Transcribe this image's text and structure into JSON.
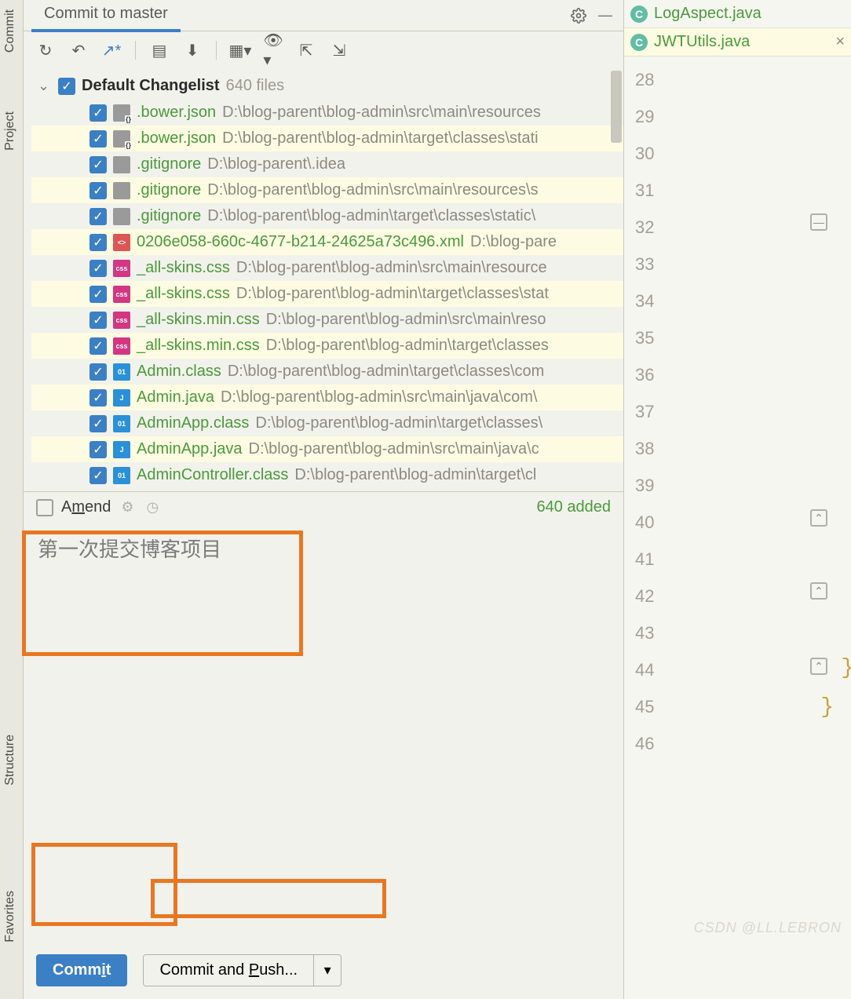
{
  "rail": {
    "commit": "Commit",
    "project": "Project",
    "structure": "Structure",
    "favorites": "Favorites"
  },
  "tab_title": "Commit to master",
  "changelist": {
    "name": "Default Changelist",
    "count": "640 files"
  },
  "files": [
    {
      "icon": "json",
      "name": ".bower.json",
      "path": "D:\\blog-parent\\blog-admin\\src\\main\\resources",
      "hl": false
    },
    {
      "icon": "json",
      "name": ".bower.json",
      "path": "D:\\blog-parent\\blog-admin\\target\\classes\\stati",
      "hl": true
    },
    {
      "icon": "txt",
      "name": ".gitignore",
      "path": "D:\\blog-parent\\.idea",
      "hl": false
    },
    {
      "icon": "txt",
      "name": ".gitignore",
      "path": "D:\\blog-parent\\blog-admin\\src\\main\\resources\\s",
      "hl": true
    },
    {
      "icon": "txt",
      "name": ".gitignore",
      "path": "D:\\blog-parent\\blog-admin\\target\\classes\\static\\",
      "hl": false
    },
    {
      "icon": "xml",
      "name": "0206e058-660c-4677-b214-24625a73c496.xml",
      "path": "D:\\blog-pare",
      "hl": true
    },
    {
      "icon": "css",
      "name": "_all-skins.css",
      "path": "D:\\blog-parent\\blog-admin\\src\\main\\resource",
      "hl": false
    },
    {
      "icon": "css",
      "name": "_all-skins.css",
      "path": "D:\\blog-parent\\blog-admin\\target\\classes\\stat",
      "hl": true
    },
    {
      "icon": "css",
      "name": "_all-skins.min.css",
      "path": "D:\\blog-parent\\blog-admin\\src\\main\\reso",
      "hl": false
    },
    {
      "icon": "css",
      "name": "_all-skins.min.css",
      "path": "D:\\blog-parent\\blog-admin\\target\\classes",
      "hl": true
    },
    {
      "icon": "cls",
      "name": "Admin.class",
      "path": "D:\\blog-parent\\blog-admin\\target\\classes\\com",
      "hl": false
    },
    {
      "icon": "java",
      "name": "Admin.java",
      "path": "D:\\blog-parent\\blog-admin\\src\\main\\java\\com\\",
      "hl": true
    },
    {
      "icon": "cls",
      "name": "AdminApp.class",
      "path": "D:\\blog-parent\\blog-admin\\target\\classes\\",
      "hl": false
    },
    {
      "icon": "java",
      "name": "AdminApp.java",
      "path": "D:\\blog-parent\\blog-admin\\src\\main\\java\\c",
      "hl": true
    },
    {
      "icon": "cls",
      "name": "AdminController.class",
      "path": "D:\\blog-parent\\blog-admin\\target\\cl",
      "hl": false
    }
  ],
  "amend": {
    "label_pre": "A",
    "label_u": "m",
    "label_post": "end"
  },
  "status": "640 added",
  "commit_message": "第一次提交博客项目",
  "buttons": {
    "commit_pre": "Comm",
    "commit_u": "i",
    "commit_post": "t",
    "push_pre": "Commit and ",
    "push_u": "P",
    "push_post": "ush..."
  },
  "editor_tabs": [
    {
      "name": "LogAspect.java",
      "closable": false
    },
    {
      "name": "JWTUtils.java",
      "closable": true
    }
  ],
  "line_numbers": [
    "28",
    "29",
    "30",
    "31",
    "32",
    "33",
    "34",
    "35",
    "36",
    "37",
    "38",
    "39",
    "40",
    "41",
    "42",
    "43",
    "44",
    "45",
    "46"
  ],
  "watermark": "CSDN @LL.LEBRON",
  "file_icon_labels": {
    "json": "",
    "txt": "",
    "xml": "<>",
    "css": "css",
    "cls": "01",
    "java": "J"
  }
}
